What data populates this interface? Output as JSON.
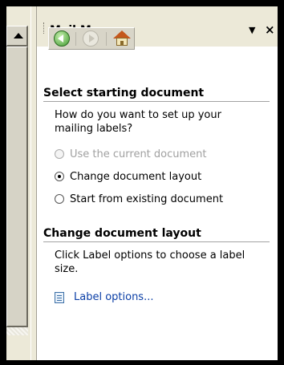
{
  "pane": {
    "title": "Mail Merge",
    "dropdown_glyph": "▼",
    "close_glyph": "×"
  },
  "nav": {
    "icons": [
      "back-icon",
      "forward-icon",
      "home-icon"
    ]
  },
  "section1": {
    "heading": "Select starting document",
    "question": "How do you want to set up your mailing labels?",
    "options": [
      {
        "label": "Use the current document",
        "enabled": false,
        "checked": false
      },
      {
        "label": "Change document layout",
        "enabled": true,
        "checked": true
      },
      {
        "label": "Start from existing document",
        "enabled": true,
        "checked": false
      }
    ]
  },
  "section2": {
    "heading": "Change document layout",
    "description": "Click Label options to choose a label size.",
    "link_label": "Label options..."
  },
  "colors": {
    "link": "#0a3ea6",
    "header_bg": "#ece9d8",
    "disabled_text": "#a0a0a0"
  }
}
